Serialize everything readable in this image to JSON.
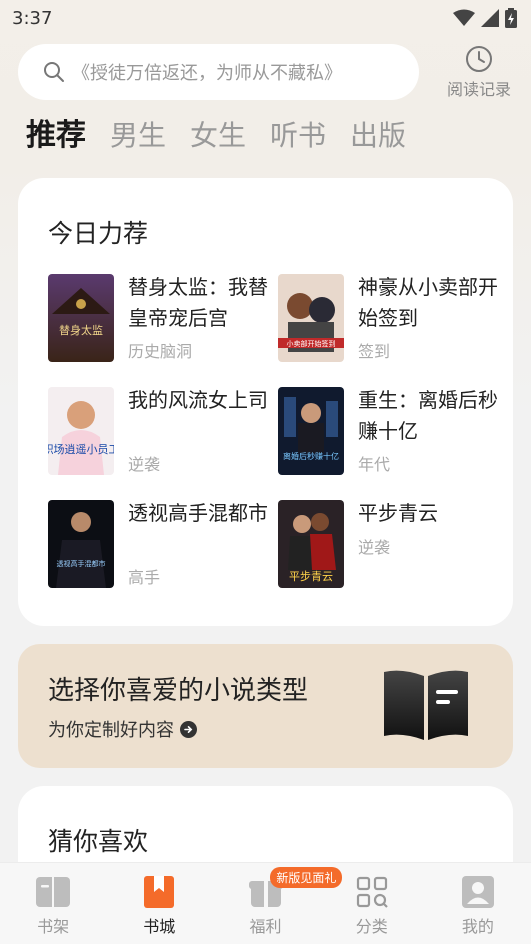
{
  "status_bar": {
    "time": "3:37"
  },
  "search": {
    "placeholder": "《授徒万倍返还，为师从不藏私》"
  },
  "history": {
    "label": "阅读记录"
  },
  "tabs": [
    {
      "label": "推荐",
      "active": true
    },
    {
      "label": "男生",
      "active": false
    },
    {
      "label": "女生",
      "active": false
    },
    {
      "label": "听书",
      "active": false
    },
    {
      "label": "出版",
      "active": false
    }
  ],
  "today": {
    "title": "今日力荐",
    "books": [
      {
        "title": "替身太监：我替皇帝宠后宫",
        "tag": "历史脑洞",
        "cover_text": "替身太监"
      },
      {
        "title": "神豪从小卖部开始签到",
        "tag": "签到",
        "cover_text": "小卖部开始签到"
      },
      {
        "title": "我的风流女上司",
        "tag": "逆袭",
        "cover_text": "职场逍遥小员工"
      },
      {
        "title": "重生：离婚后秒赚十亿",
        "tag": "年代",
        "cover_text": "离婚后秒赚十亿"
      },
      {
        "title": "透视高手混都市",
        "tag": "高手",
        "cover_text": "透视高手混都市"
      },
      {
        "title": "平步青云",
        "tag": "逆袭",
        "cover_text": "平步青云"
      }
    ]
  },
  "banner": {
    "title": "选择你喜爱的小说类型",
    "subtitle": "为你定制好内容"
  },
  "guess": {
    "title": "猜你喜欢"
  },
  "nav": [
    {
      "label": "书架",
      "icon": "bookshelf-icon"
    },
    {
      "label": "书城",
      "icon": "bookstore-icon",
      "active": true
    },
    {
      "label": "福利",
      "icon": "gift-icon",
      "badge": "新版见面礼"
    },
    {
      "label": "分类",
      "icon": "category-icon"
    },
    {
      "label": "我的",
      "icon": "profile-icon"
    }
  ],
  "colors": {
    "accent": "#f46b2a",
    "banner_bg": "#ede0cf"
  }
}
